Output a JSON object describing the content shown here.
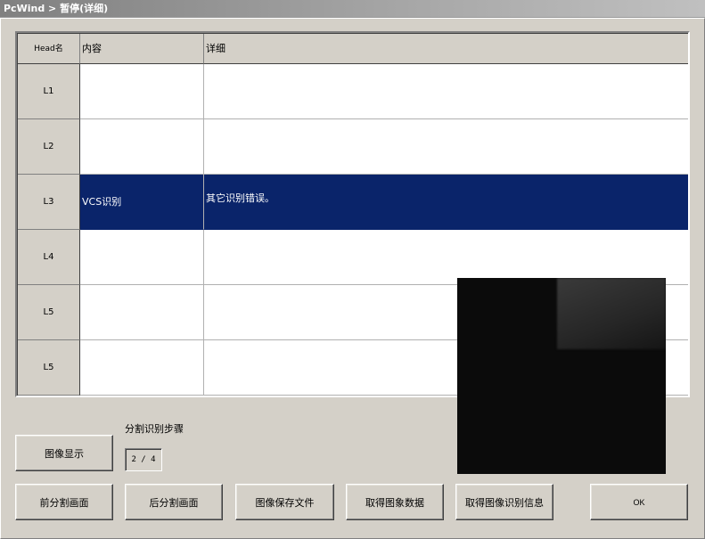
{
  "window": {
    "title": "PcWind > 暂停(详细)"
  },
  "grid": {
    "columns": [
      "Head名",
      "内容",
      "详细"
    ],
    "rows": [
      {
        "head": "L1",
        "content": "",
        "detail": ""
      },
      {
        "head": "L2",
        "content": "",
        "detail": ""
      },
      {
        "head": "L3",
        "content": "VCS识别",
        "detail": "其它识别错误。",
        "selected": true
      },
      {
        "head": "L4",
        "content": "",
        "detail": ""
      },
      {
        "head": "L5",
        "content": "",
        "detail": ""
      },
      {
        "head": "L5",
        "content": "",
        "detail": ""
      }
    ]
  },
  "step": {
    "label": "分割识别步骤",
    "value": "2 / 4"
  },
  "buttons": {
    "image_display": "图像显示",
    "prev_segment": "前分割画面",
    "next_segment": "后分割画面",
    "save_image": "图像保存文件",
    "get_image_data": "取得图象数据",
    "get_recognition_info": "取得图像识别信息",
    "ok": "OK"
  },
  "colors": {
    "selection": "#0a246a",
    "face": "#d4d0c8"
  }
}
